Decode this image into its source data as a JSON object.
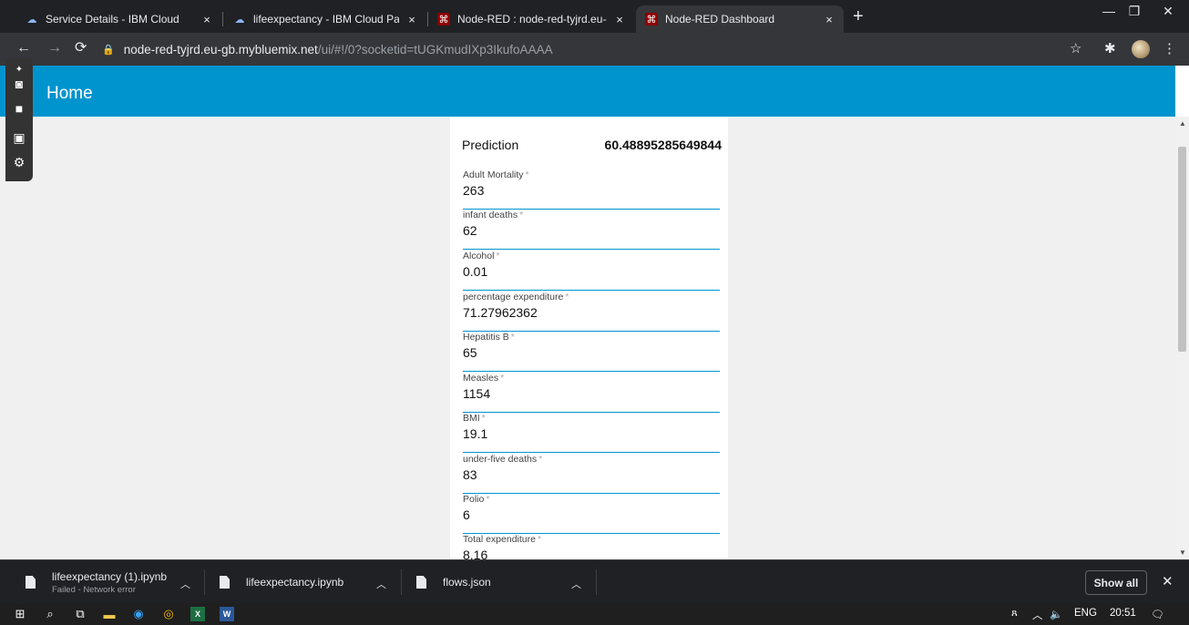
{
  "browser": {
    "tabs": [
      {
        "title": "Service Details - IBM Cloud",
        "close": "×",
        "favicon": "ibm-cloud-icon"
      },
      {
        "title": "lifeexpectancy - IBM Cloud Pak fo",
        "close": "×",
        "favicon": "ibm-cloud-icon"
      },
      {
        "title": "Node-RED : node-red-tyjrd.eu-gb",
        "close": "×",
        "favicon": "node-red-icon"
      },
      {
        "title": "Node-RED Dashboard",
        "close": "×",
        "favicon": "node-red-icon",
        "active": true
      }
    ],
    "new_tab": "+",
    "address": {
      "host": "node-red-tyjrd.eu-gb.mybluemix.net",
      "path": "/ui/#!/0?socketid=tUGKmudIXp3IkufoAAAA"
    }
  },
  "dashboard": {
    "title": "Home",
    "prediction_label": "Prediction",
    "prediction_value": "60.48895285649844",
    "required_mark": "*",
    "fields": [
      {
        "label": "Adult Mortality",
        "value": "263"
      },
      {
        "label": "infant deaths",
        "value": "62"
      },
      {
        "label": "Alcohol",
        "value": "0.01"
      },
      {
        "label": "percentage expenditure",
        "value": "71.27962362"
      },
      {
        "label": "Hepatitis B",
        "value": "65"
      },
      {
        "label": "Measles",
        "value": "1154"
      },
      {
        "label": "BMI",
        "value": "19.1"
      },
      {
        "label": "under-five deaths",
        "value": "83"
      },
      {
        "label": "Polio",
        "value": "6"
      },
      {
        "label": "Total expenditure",
        "value": "8.16"
      }
    ]
  },
  "downloads": {
    "items": [
      {
        "name": "lifeexpectancy (1).ipynb",
        "status": "Failed - Network error"
      },
      {
        "name": "lifeexpectancy.ipynb",
        "status": ""
      },
      {
        "name": "flows.json",
        "status": ""
      }
    ],
    "show_all": "Show all"
  },
  "taskbar": {
    "language": "ENG",
    "time": "20:51"
  },
  "colors": {
    "accent": "#0094ce",
    "chrome_dark": "#202124",
    "chrome_toolbar": "#35363a"
  }
}
